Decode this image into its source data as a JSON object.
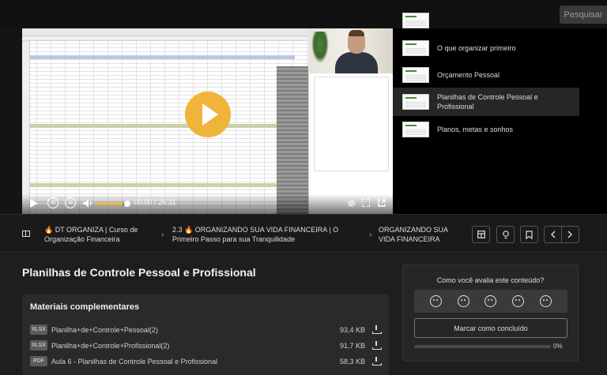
{
  "header": {
    "search_label": "Pesquisar"
  },
  "player": {
    "current_time": "00:00",
    "separator": "/",
    "duration": "26:31",
    "skip_back_label": "10",
    "skip_forward_label": "10",
    "volume": 0.85
  },
  "playlist": {
    "items": [
      {
        "label": "O que organizar primeiro",
        "active": false
      },
      {
        "label": "Orçamento Pessoal",
        "active": false
      },
      {
        "label": "Planilhas de Controle Pessoal e Profissional",
        "active": true
      },
      {
        "label": "Planos, metas e sonhos",
        "active": false
      }
    ]
  },
  "breadcrumb": {
    "course": "🔥 DT ORGANIZA | Curso de Organização Financeira",
    "module": "2.3 🔥 ORGANIZANDO SUA VIDA FINANCEIRA | O Primeiro Passo para sua Tranquilidade",
    "section": "ORGANIZANDO SUA VIDA FINANCEIRA"
  },
  "lesson": {
    "title": "Planilhas de Controle Pessoal e Profissional"
  },
  "materials": {
    "heading": "Materiais complementares",
    "files": [
      {
        "type": "XLSX",
        "name": "Planilha+de+Controle+Pessoal(2)",
        "size": "93,4 KB"
      },
      {
        "type": "XLSX",
        "name": "Planilha+de+Controle+Profissional(2)",
        "size": "91,7 KB"
      },
      {
        "type": "PDF",
        "name": "Aula 6 - Planilhas de Controle Pessoal e Profissional",
        "size": "58,3 KB"
      }
    ]
  },
  "rating": {
    "question": "Como você avalia este conteúdo?",
    "mark_complete_label": "Marcar como concluído",
    "progress_label": "0%",
    "progress": 0
  },
  "colors": {
    "accent": "#f0b43a",
    "background": "#141414"
  }
}
